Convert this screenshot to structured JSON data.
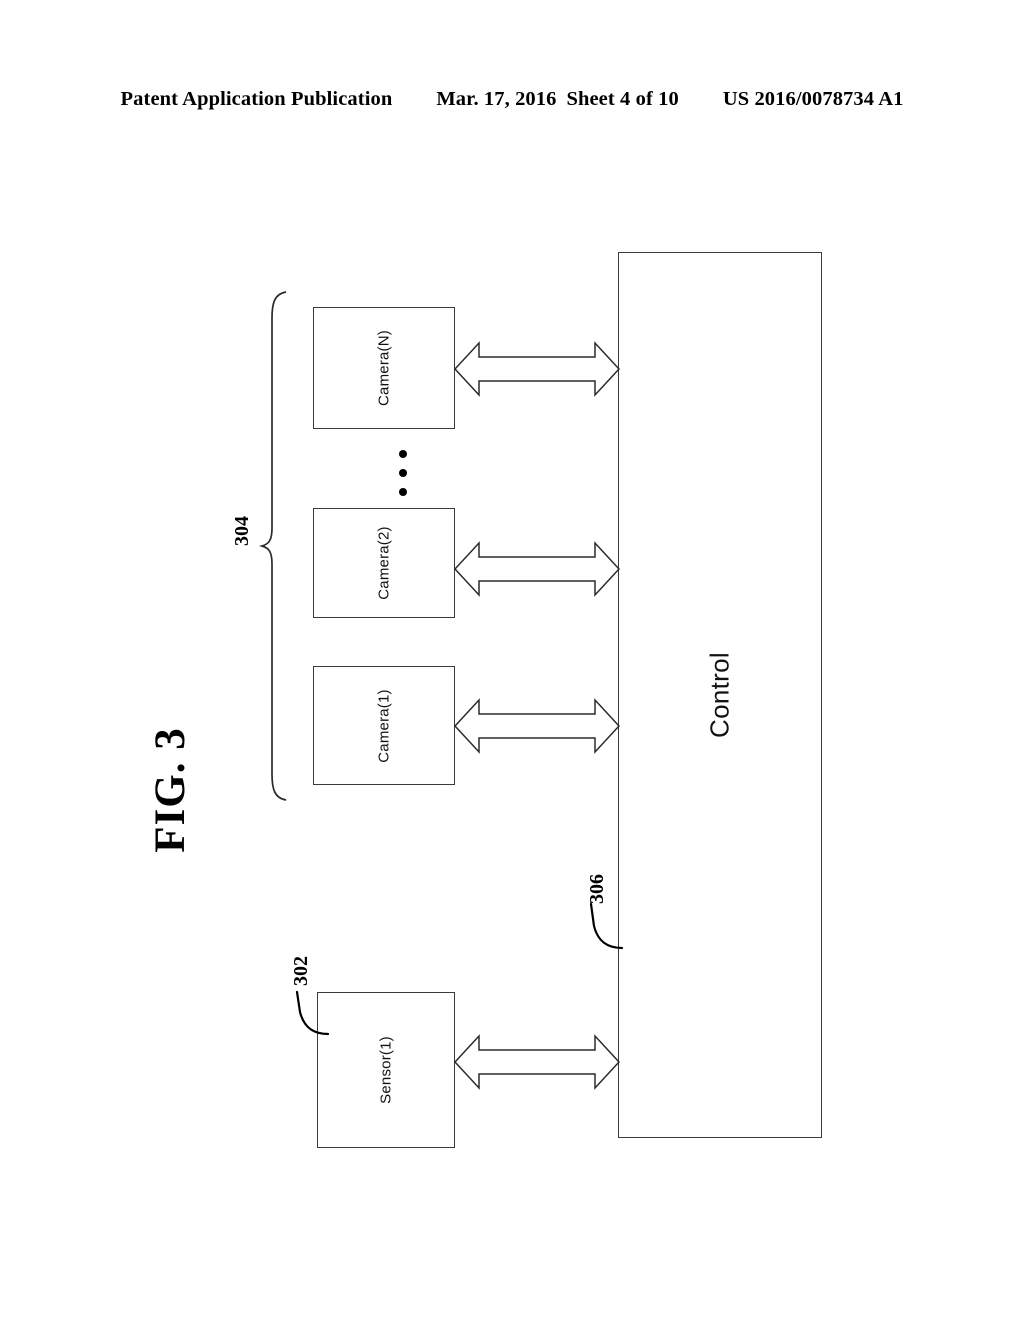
{
  "header": {
    "publication": "Patent Application Publication",
    "date": "Mar. 17, 2016",
    "sheet": "Sheet 4 of 10",
    "document_number": "US 2016/0078734 A1"
  },
  "figure": {
    "label": "FIG. 3",
    "blocks": [
      {
        "id": "camera-n",
        "label": "Camera(N)"
      },
      {
        "id": "camera-2",
        "label": "Camera(2)"
      },
      {
        "id": "camera-1",
        "label": "Camera(1)"
      },
      {
        "id": "sensor-1",
        "label": "Sensor(1)"
      },
      {
        "id": "control",
        "label": "Control"
      }
    ],
    "reference_numerals": [
      {
        "id": "302",
        "value": "302",
        "points_to": "Sensor(1) block"
      },
      {
        "id": "304",
        "value": "304",
        "points_to": "Camera block group brace"
      },
      {
        "id": "306",
        "value": "306",
        "points_to": "Control block left edge"
      }
    ],
    "ellipsis": "vertical-ellipsis between Camera(N) and Camera(2)",
    "connectors": [
      {
        "from": "Camera(N)",
        "to": "Control",
        "style": "double-headed-arrow"
      },
      {
        "from": "Camera(2)",
        "to": "Control",
        "style": "double-headed-arrow"
      },
      {
        "from": "Camera(1)",
        "to": "Control",
        "style": "double-headed-arrow"
      },
      {
        "from": "Sensor(1)",
        "to": "Control",
        "style": "double-headed-arrow"
      }
    ],
    "colors": {
      "ink": "#000000",
      "line": "#2b2b2b",
      "background": "#ffffff"
    }
  }
}
